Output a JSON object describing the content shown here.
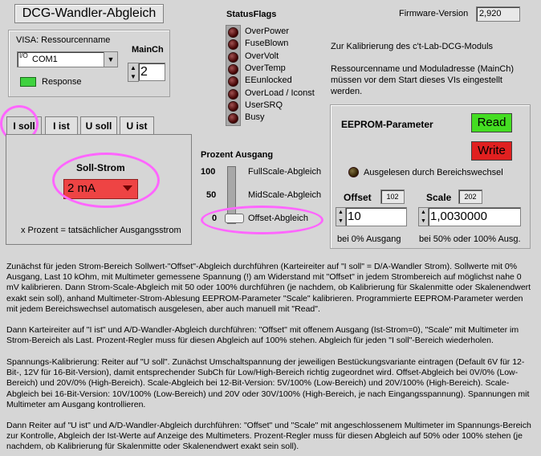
{
  "app": {
    "title": "DCG-Wandler-Abgleich"
  },
  "firmware": {
    "label": "Firmware-Version",
    "value": "2,920"
  },
  "visa": {
    "label": "VISA: Ressourcenname",
    "value": "COM1",
    "prefix": "I/O",
    "response_label": "Response"
  },
  "mainch": {
    "label": "MainCh",
    "value": "2"
  },
  "status": {
    "title": "StatusFlags",
    "flags": [
      "OverPower",
      "FuseBlown",
      "OverVolt",
      "OverTemp",
      "EEunlocked",
      "OverLoad / Iconst",
      "UserSRQ",
      "Busy"
    ]
  },
  "info": {
    "line1": "Zur Kalibrierung des c't-Lab-DCG-Moduls",
    "line2": "Ressourcenname und Moduladresse (MainCh)",
    "line3": "müssen vor dem Start dieses VIs eingestellt",
    "line4": "werden."
  },
  "tabs": [
    "I soll",
    "I ist",
    "U soll",
    "U ist"
  ],
  "soll": {
    "label": "Soll-Strom",
    "value": "2 mA",
    "note": "x Prozent = tatsächlicher Ausgangsstrom"
  },
  "prozent": {
    "title": "Prozent Ausgang",
    "ticks": [
      "100",
      "50",
      "0"
    ],
    "labels": [
      "FullScale-Abgleich",
      "MidScale-Abgleich",
      "Offset-Abgleich"
    ],
    "level": 0
  },
  "eeprom": {
    "title": "EEPROM-Parameter",
    "read_label": "Read",
    "write_label": "Write",
    "auto_label": "Ausgelesen durch Bereichswechsel",
    "offset_label": "Offset",
    "offset_addr": "102",
    "offset_value": "10",
    "offset_note": "bei 0% Ausgang",
    "scale_label": "Scale",
    "scale_addr": "202",
    "scale_value": "1,0030000",
    "scale_note": "bei 50% oder 100% Ausg.",
    "read_color": "#44dd22",
    "write_color": "#e02020"
  },
  "help": {
    "p1": "Zunächst für jeden Strom-Bereich Sollwert-\"Offset\"-Abgleich durchführen (Karteireiter auf \"I  soll\"  = D/A-Wandler Strom). Sollwerte mit 0% Ausgang, Last 10 kOhm, mit Multimeter gemessene Spannung (!) am Widerstand mit \"Offset\" in jedem Strombereich auf möglichst nahe 0 mV kalibrieren. Dann Strom-Scale-Abgleich mit 50 oder 100% durchführen (je nachdem, ob Kalibrierung für Skalenmitte oder Skalenendwert exakt sein soll), anhand Multimeter-Strom-Ablesung EEPROM-Parameter \"Scale\" kalibrieren. Programmierte EEPROM-Parameter werden mit jedem Bereichswechsel automatisch ausgelesen, aber auch manuell mit \"Read\".",
    "p2": "Dann Karteireiter auf \"I ist\" und A/D-Wandler-Abgleich durchführen: \"Offset\" mit offenem Ausgang (Ist-Strom=0), \"Scale\" mit Multimeter im Strom-Bereich als Last. Prozent-Regler muss für diesen Abgleich auf 100% stehen. Abgleich für jeden \"I soll\"-Bereich wiederholen.",
    "p3": "Spannungs-Kalibrierung: Reiter auf \"U soll\". Zunächst Umschaltspannung der jeweiligen Bestückungsvariante eintragen (Default 6V für 12-Bit-, 12V für 16-Bit-Version), damit entsprechender SubCh für Low/High-Bereich richtig zugeordnet wird. Offset-Abgleich bei 0V/0% (Low-Bereich) und 20V/0% (High-Bereich). Scale-Abgleich bei 12-Bit-Version: 5V/100% (Low-Bereich) und 20V/100% (High-Bereich). Scale-Abgleich bei 16-Bit-Version: 10V/100% (Low-Bereich) und 20V oder 30V/100% (High-Bereich, je nach Eingangsspannung). Spannungen mit Multimeter am Ausgang kontrollieren.",
    "p4": "Dann Reiter auf \"U ist\" und A/D-Wandler-Abgleich durchführen: \"Offset\" und \"Scale\" mit angeschlossenem Multimeter im Spannungs-Bereich zur Kontrolle, Abgleich der Ist-Werte auf Anzeige des Multimeters. Prozent-Regler muss für diesen Abgleich auf 50% oder 100% stehen  (je nachdem, ob Kalibrierung für Skalenmitte oder Skalenendwert exakt sein soll)."
  }
}
